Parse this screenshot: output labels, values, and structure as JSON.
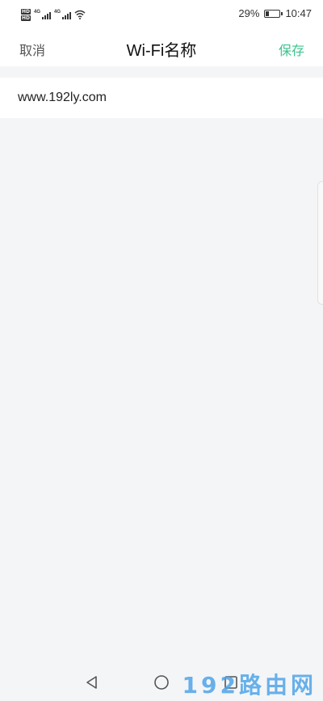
{
  "status_bar": {
    "hd_badge_1": "HD",
    "hd_badge_2": "HD",
    "network_1": "4G",
    "network_2": "4G",
    "battery_percent": "29%",
    "battery_level": 0.29,
    "time": "10:47"
  },
  "nav": {
    "cancel_label": "取消",
    "title": "Wi-Fi名称",
    "save_label": "保存"
  },
  "form": {
    "ssid_value": "www.192ly.com"
  },
  "system_nav": {
    "back_icon": "triangle-back-icon",
    "home_icon": "circle-home-icon",
    "recent_icon": "square-recent-icon"
  },
  "watermark": {
    "text": "192路由网"
  },
  "colors": {
    "accent": "#3cc48f",
    "background": "#f4f5f7",
    "watermark": "#4da3e8"
  }
}
